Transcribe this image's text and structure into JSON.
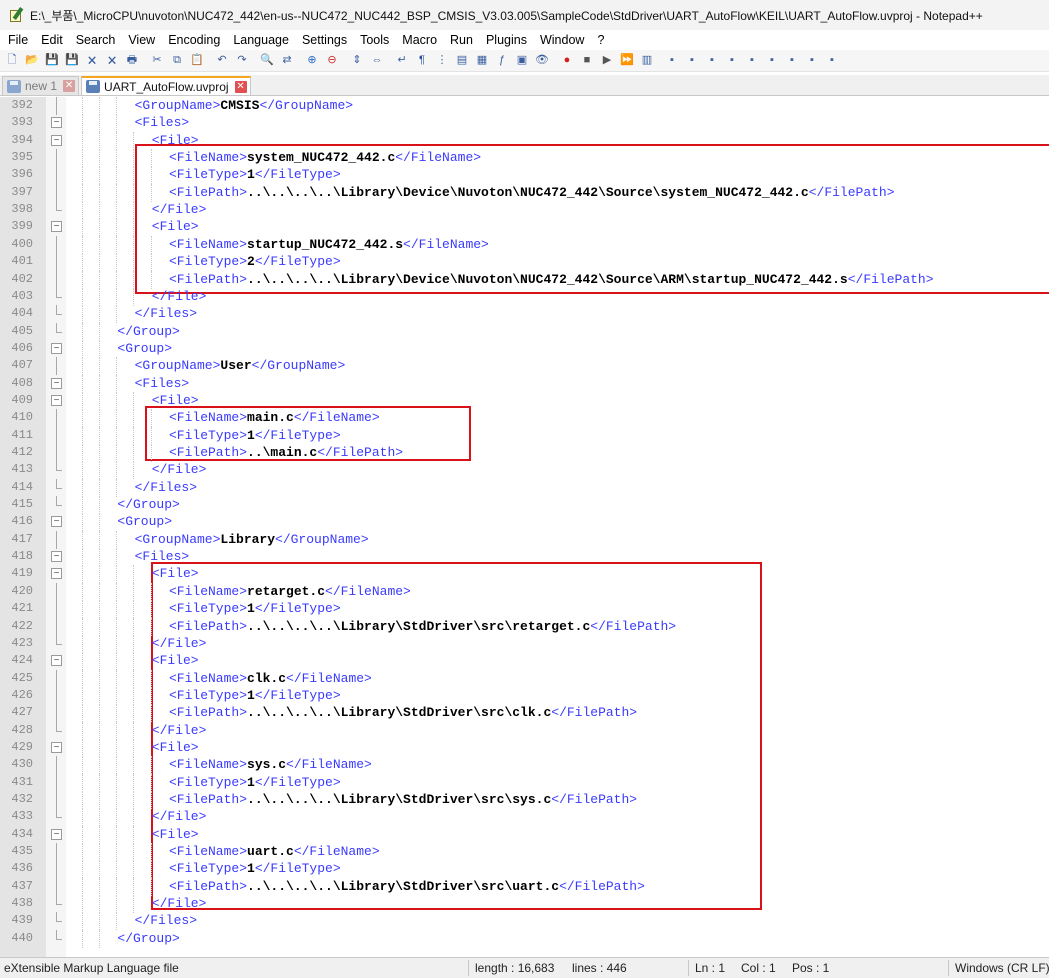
{
  "window": {
    "title": "E:\\_부품\\_MicroCPU\\nuvoton\\NUC472_442\\en-us--NUC472_NUC442_BSP_CMSIS_V3.03.005\\SampleCode\\StdDriver\\UART_AutoFlow\\KEIL\\UART_AutoFlow.uvproj - Notepad++"
  },
  "menu": [
    "File",
    "Edit",
    "Search",
    "View",
    "Encoding",
    "Language",
    "Settings",
    "Tools",
    "Macro",
    "Run",
    "Plugins",
    "Window",
    "?"
  ],
  "toolbar_icons": [
    "new-file-icon",
    "open-file-icon",
    "save-icon",
    "save-all-icon",
    "close-icon",
    "close-all-icon",
    "print-icon",
    "cut-icon",
    "copy-icon",
    "paste-icon",
    "undo-icon",
    "redo-icon",
    "find-icon",
    "replace-icon",
    "zoom-in-icon",
    "zoom-out-icon",
    "sync-vertical-icon",
    "sync-horizontal-icon",
    "word-wrap-icon",
    "show-all-chars-icon",
    "indent-guide-icon",
    "udl-icon",
    "doc-map-icon",
    "function-list-icon",
    "folder-workspace-icon",
    "monitor-icon",
    "record-macro-icon",
    "stop-macro-icon",
    "play-macro-icon",
    "run-macro-multiple-icon",
    "save-macro-icon",
    "plugin-1-icon",
    "plugin-2-icon",
    "plugin-3-icon",
    "plugin-4-icon",
    "plugin-5-icon",
    "plugin-6-icon",
    "plugin-7-icon",
    "plugin-8-icon",
    "plugin-9-icon"
  ],
  "tabs": [
    {
      "label": "new 1",
      "active": false
    },
    {
      "label": "UART_AutoFlow.uvproj",
      "active": true
    }
  ],
  "editor": {
    "lines": [
      {
        "n": "392",
        "indent": 4,
        "parts": [
          [
            "tag",
            "<GroupName>"
          ],
          [
            "txt",
            "CMSIS"
          ],
          [
            "tag",
            "</GroupName>"
          ]
        ]
      },
      {
        "n": "393",
        "indent": 4,
        "fold": "open",
        "parts": [
          [
            "tag",
            "<Files>"
          ]
        ]
      },
      {
        "n": "394",
        "indent": 5,
        "fold": "open",
        "parts": [
          [
            "tag",
            "<File>"
          ]
        ]
      },
      {
        "n": "395",
        "indent": 6,
        "parts": [
          [
            "tag",
            "<FileName>"
          ],
          [
            "txt",
            "system_NUC472_442.c"
          ],
          [
            "tag",
            "</FileName>"
          ]
        ]
      },
      {
        "n": "396",
        "indent": 6,
        "parts": [
          [
            "tag",
            "<FileType>"
          ],
          [
            "txt",
            "1"
          ],
          [
            "tag",
            "</FileType>"
          ]
        ]
      },
      {
        "n": "397",
        "indent": 6,
        "parts": [
          [
            "tag",
            "<FilePath>"
          ],
          [
            "txt",
            "..\\..\\..\\..\\Library\\Device\\Nuvoton\\NUC472_442\\Source\\system_NUC472_442.c"
          ],
          [
            "tag",
            "</FilePath>"
          ]
        ]
      },
      {
        "n": "398",
        "indent": 5,
        "fold": "end",
        "parts": [
          [
            "tag",
            "</File>"
          ]
        ]
      },
      {
        "n": "399",
        "indent": 5,
        "fold": "open",
        "parts": [
          [
            "tag",
            "<File>"
          ]
        ]
      },
      {
        "n": "400",
        "indent": 6,
        "parts": [
          [
            "tag",
            "<FileName>"
          ],
          [
            "txt",
            "startup_NUC472_442.s"
          ],
          [
            "tag",
            "</FileName>"
          ]
        ]
      },
      {
        "n": "401",
        "indent": 6,
        "parts": [
          [
            "tag",
            "<FileType>"
          ],
          [
            "txt",
            "2"
          ],
          [
            "tag",
            "</FileType>"
          ]
        ]
      },
      {
        "n": "402",
        "indent": 6,
        "parts": [
          [
            "tag",
            "<FilePath>"
          ],
          [
            "txt",
            "..\\..\\..\\..\\Library\\Device\\Nuvoton\\NUC472_442\\Source\\ARM\\startup_NUC472_442.s"
          ],
          [
            "tag",
            "</FilePath>"
          ]
        ]
      },
      {
        "n": "403",
        "indent": 5,
        "fold": "end",
        "parts": [
          [
            "tag",
            "</File>"
          ]
        ]
      },
      {
        "n": "404",
        "indent": 4,
        "fold": "end",
        "parts": [
          [
            "tag",
            "</Files>"
          ]
        ]
      },
      {
        "n": "405",
        "indent": 3,
        "fold": "end",
        "parts": [
          [
            "tag",
            "</Group>"
          ]
        ]
      },
      {
        "n": "406",
        "indent": 3,
        "fold": "open",
        "parts": [
          [
            "tag",
            "<Group>"
          ]
        ]
      },
      {
        "n": "407",
        "indent": 4,
        "parts": [
          [
            "tag",
            "<GroupName>"
          ],
          [
            "txt",
            "User"
          ],
          [
            "tag",
            "</GroupName>"
          ]
        ]
      },
      {
        "n": "408",
        "indent": 4,
        "fold": "open",
        "parts": [
          [
            "tag",
            "<Files>"
          ]
        ]
      },
      {
        "n": "409",
        "indent": 5,
        "fold": "open",
        "parts": [
          [
            "tag",
            "<File>"
          ]
        ]
      },
      {
        "n": "410",
        "indent": 6,
        "parts": [
          [
            "tag",
            "<FileName>"
          ],
          [
            "txt",
            "main.c"
          ],
          [
            "tag",
            "</FileName>"
          ]
        ]
      },
      {
        "n": "411",
        "indent": 6,
        "parts": [
          [
            "tag",
            "<FileType>"
          ],
          [
            "txt",
            "1"
          ],
          [
            "tag",
            "</FileType>"
          ]
        ]
      },
      {
        "n": "412",
        "indent": 6,
        "parts": [
          [
            "tag",
            "<FilePath>"
          ],
          [
            "txt",
            "..\\main.c"
          ],
          [
            "tag",
            "</FilePath>"
          ]
        ]
      },
      {
        "n": "413",
        "indent": 5,
        "fold": "end",
        "parts": [
          [
            "tag",
            "</File>"
          ]
        ]
      },
      {
        "n": "414",
        "indent": 4,
        "fold": "end",
        "parts": [
          [
            "tag",
            "</Files>"
          ]
        ]
      },
      {
        "n": "415",
        "indent": 3,
        "fold": "end",
        "parts": [
          [
            "tag",
            "</Group>"
          ]
        ]
      },
      {
        "n": "416",
        "indent": 3,
        "fold": "open",
        "parts": [
          [
            "tag",
            "<Group>"
          ]
        ]
      },
      {
        "n": "417",
        "indent": 4,
        "parts": [
          [
            "tag",
            "<GroupName>"
          ],
          [
            "txt",
            "Library"
          ],
          [
            "tag",
            "</GroupName>"
          ]
        ]
      },
      {
        "n": "418",
        "indent": 4,
        "fold": "open",
        "parts": [
          [
            "tag",
            "<Files>"
          ]
        ]
      },
      {
        "n": "419",
        "indent": 5,
        "fold": "open",
        "parts": [
          [
            "tag",
            "<File>"
          ]
        ]
      },
      {
        "n": "420",
        "indent": 6,
        "parts": [
          [
            "tag",
            "<FileName>"
          ],
          [
            "txt",
            "retarget.c"
          ],
          [
            "tag",
            "</FileName>"
          ]
        ]
      },
      {
        "n": "421",
        "indent": 6,
        "parts": [
          [
            "tag",
            "<FileType>"
          ],
          [
            "txt",
            "1"
          ],
          [
            "tag",
            "</FileType>"
          ]
        ]
      },
      {
        "n": "422",
        "indent": 6,
        "parts": [
          [
            "tag",
            "<FilePath>"
          ],
          [
            "txt",
            "..\\..\\..\\..\\Library\\StdDriver\\src\\retarget.c"
          ],
          [
            "tag",
            "</FilePath>"
          ]
        ]
      },
      {
        "n": "423",
        "indent": 5,
        "fold": "end",
        "parts": [
          [
            "tag",
            "</File>"
          ]
        ]
      },
      {
        "n": "424",
        "indent": 5,
        "fold": "open",
        "parts": [
          [
            "tag",
            "<File>"
          ]
        ]
      },
      {
        "n": "425",
        "indent": 6,
        "parts": [
          [
            "tag",
            "<FileName>"
          ],
          [
            "txt",
            "clk.c"
          ],
          [
            "tag",
            "</FileName>"
          ]
        ]
      },
      {
        "n": "426",
        "indent": 6,
        "parts": [
          [
            "tag",
            "<FileType>"
          ],
          [
            "txt",
            "1"
          ],
          [
            "tag",
            "</FileType>"
          ]
        ]
      },
      {
        "n": "427",
        "indent": 6,
        "parts": [
          [
            "tag",
            "<FilePath>"
          ],
          [
            "txt",
            "..\\..\\..\\..\\Library\\StdDriver\\src\\clk.c"
          ],
          [
            "tag",
            "</FilePath>"
          ]
        ]
      },
      {
        "n": "428",
        "indent": 5,
        "fold": "end",
        "parts": [
          [
            "tag",
            "</File>"
          ]
        ]
      },
      {
        "n": "429",
        "indent": 5,
        "fold": "open",
        "parts": [
          [
            "tag",
            "<File>"
          ]
        ]
      },
      {
        "n": "430",
        "indent": 6,
        "parts": [
          [
            "tag",
            "<FileName>"
          ],
          [
            "txt",
            "sys.c"
          ],
          [
            "tag",
            "</FileName>"
          ]
        ]
      },
      {
        "n": "431",
        "indent": 6,
        "parts": [
          [
            "tag",
            "<FileType>"
          ],
          [
            "txt",
            "1"
          ],
          [
            "tag",
            "</FileType>"
          ]
        ]
      },
      {
        "n": "432",
        "indent": 6,
        "parts": [
          [
            "tag",
            "<FilePath>"
          ],
          [
            "txt",
            "..\\..\\..\\..\\Library\\StdDriver\\src\\sys.c"
          ],
          [
            "tag",
            "</FilePath>"
          ]
        ]
      },
      {
        "n": "433",
        "indent": 5,
        "fold": "end",
        "parts": [
          [
            "tag",
            "</File>"
          ]
        ]
      },
      {
        "n": "434",
        "indent": 5,
        "fold": "open",
        "parts": [
          [
            "tag",
            "<File>"
          ]
        ]
      },
      {
        "n": "435",
        "indent": 6,
        "parts": [
          [
            "tag",
            "<FileName>"
          ],
          [
            "txt",
            "uart.c"
          ],
          [
            "tag",
            "</FileName>"
          ]
        ]
      },
      {
        "n": "436",
        "indent": 6,
        "parts": [
          [
            "tag",
            "<FileType>"
          ],
          [
            "txt",
            "1"
          ],
          [
            "tag",
            "</FileType>"
          ]
        ]
      },
      {
        "n": "437",
        "indent": 6,
        "parts": [
          [
            "tag",
            "<FilePath>"
          ],
          [
            "txt",
            "..\\..\\..\\..\\Library\\StdDriver\\src\\uart.c"
          ],
          [
            "tag",
            "</FilePath>"
          ]
        ]
      },
      {
        "n": "438",
        "indent": 5,
        "fold": "end",
        "parts": [
          [
            "tag",
            "</File>"
          ]
        ]
      },
      {
        "n": "439",
        "indent": 4,
        "fold": "end",
        "parts": [
          [
            "tag",
            "</Files>"
          ]
        ]
      },
      {
        "n": "440",
        "indent": 3,
        "fold": "end",
        "parts": [
          [
            "tag",
            "</Group>"
          ]
        ]
      }
    ]
  },
  "highlight_color": "#d9121a",
  "statusbar": {
    "filetype": "eXtensible Markup Language file",
    "length": "length : 16,683",
    "lines": "lines : 446",
    "ln": "Ln : 1",
    "col": "Col : 1",
    "pos": "Pos : 1",
    "eol": "Windows (CR LF)"
  }
}
